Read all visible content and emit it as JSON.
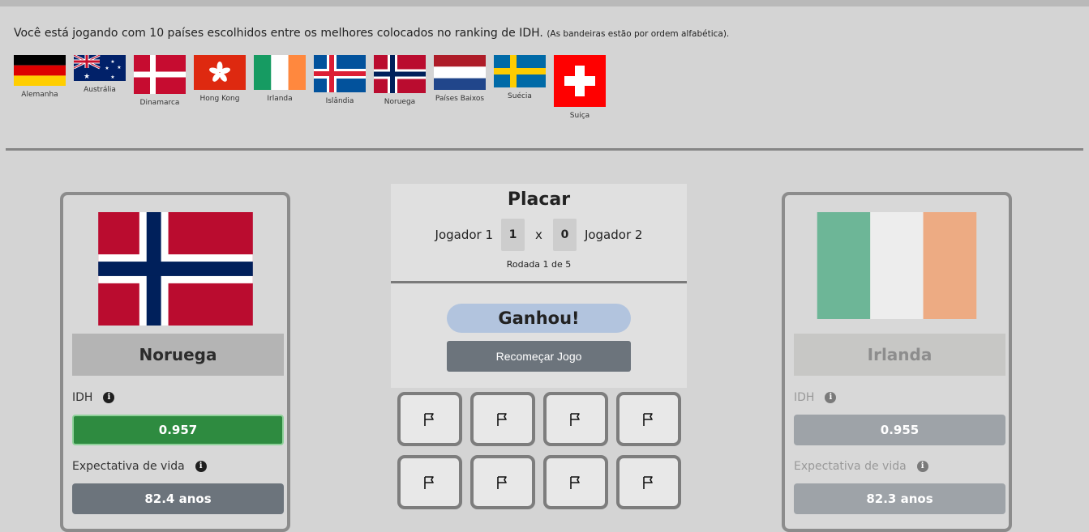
{
  "intro": {
    "main": "Você está jogando com 10 países escolhidos entre os melhores colocados no ranking de IDH.",
    "note": "(As bandeiras estão por ordem alfabética)."
  },
  "flags": [
    {
      "name": "Alemanha",
      "icon": "germany-flag-icon"
    },
    {
      "name": "Austrália",
      "icon": "australia-flag-icon"
    },
    {
      "name": "Dinamarca",
      "icon": "denmark-flag-icon"
    },
    {
      "name": "Hong Kong",
      "icon": "hong-kong-flag-icon"
    },
    {
      "name": "Irlanda",
      "icon": "ireland-flag-icon"
    },
    {
      "name": "Islândia",
      "icon": "iceland-flag-icon"
    },
    {
      "name": "Noruega",
      "icon": "norway-flag-icon"
    },
    {
      "name": "Países Baixos",
      "icon": "netherlands-flag-icon"
    },
    {
      "name": "Suécia",
      "icon": "sweden-flag-icon"
    },
    {
      "name": "Suiça",
      "icon": "switzerland-flag-icon"
    }
  ],
  "left_card": {
    "country": "Noruega",
    "idh_label": "IDH",
    "idh_value": "0.957",
    "life_label": "Expectativa de vida",
    "life_value": "82.4 anos"
  },
  "right_card": {
    "country": "Irlanda",
    "idh_label": "IDH",
    "idh_value": "0.955",
    "life_label": "Expectativa de vida",
    "life_value": "82.3 anos"
  },
  "score": {
    "title": "Placar",
    "player1": "Jogador 1",
    "player1_score": "1",
    "separator": "x",
    "player2_score": "0",
    "player2": "Jogador 2",
    "round": "Rodada 1 de 5"
  },
  "result": {
    "status": "Ganhou!",
    "restart": "Recomeçar Jogo"
  },
  "tiles": {
    "icon": "flag-outline-icon",
    "count": 8
  },
  "colors": {
    "win": "#2e8b40",
    "neutral": "#6c747c",
    "status_pill": "#b2c4de"
  }
}
